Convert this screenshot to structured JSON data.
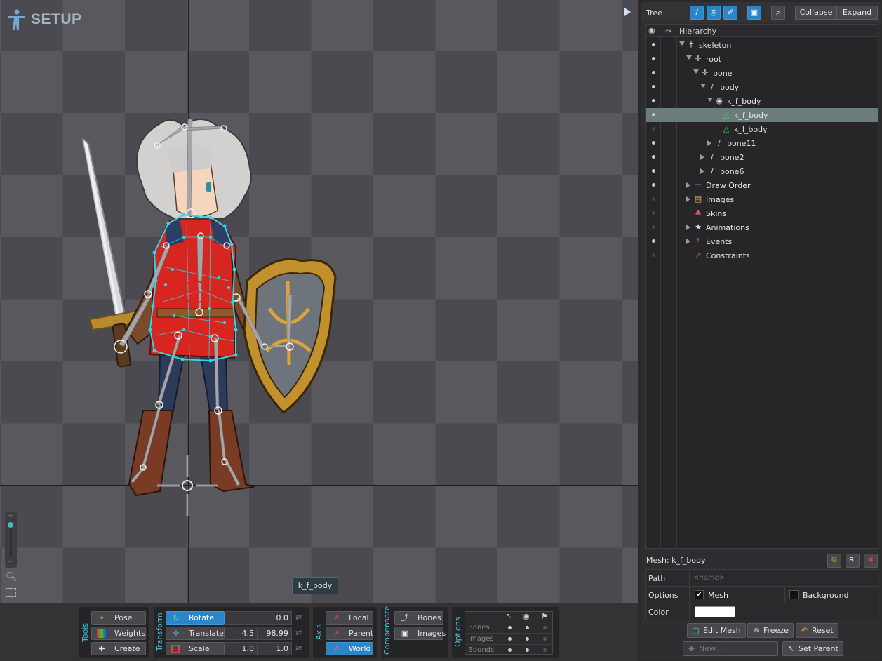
{
  "mode": {
    "label": "SETUP"
  },
  "viewport": {
    "selection_label": "k_f_body",
    "zoom": {
      "plus": "+",
      "minus": "-"
    }
  },
  "tools": {
    "title": "Tools",
    "items": [
      {
        "label": "Pose",
        "icon": "pose-icon",
        "active": false
      },
      {
        "label": "Weights",
        "icon": "weights-icon",
        "active": false
      },
      {
        "label": "Create",
        "icon": "create-icon",
        "active": false
      }
    ]
  },
  "transform": {
    "title": "Transform",
    "rotate": {
      "label": "Rotate",
      "value": "0.0",
      "active": true
    },
    "translate": {
      "label": "Translate",
      "x": "4.5",
      "y": "98.99"
    },
    "scale": {
      "label": "Scale",
      "x": "1.0",
      "y": "1.0"
    }
  },
  "axis": {
    "title": "Axis",
    "items": [
      {
        "label": "Local",
        "active": false
      },
      {
        "label": "Parent",
        "active": false
      },
      {
        "label": "World",
        "active": true
      }
    ]
  },
  "compensate": {
    "title": "Compensate",
    "items": [
      {
        "label": "Bones"
      },
      {
        "label": "Images"
      }
    ]
  },
  "options": {
    "title": "Options",
    "rows": [
      {
        "label": "Bones",
        "values": [
          true,
          true,
          false
        ]
      },
      {
        "label": "Images",
        "values": [
          true,
          true,
          false
        ]
      },
      {
        "label": "Bounds",
        "values": [
          true,
          true,
          false
        ]
      }
    ]
  },
  "tree_panel": {
    "title": "Tree",
    "collapse_label": "Collapse",
    "expand_label": "Expand",
    "header": "Hierarchy",
    "nodes": [
      {
        "label": "skeleton",
        "icon": "skeleton-icon",
        "depth": 0,
        "arrow": "down",
        "visible": true
      },
      {
        "label": "root",
        "icon": "bone-cross-icon",
        "depth": 1,
        "arrow": "down",
        "visible": true
      },
      {
        "label": "bone",
        "icon": "bone-cross-icon",
        "depth": 2,
        "arrow": "down",
        "visible": true
      },
      {
        "label": "body",
        "icon": "bone-icon",
        "depth": 3,
        "arrow": "down",
        "visible": true
      },
      {
        "label": "k_f_body",
        "icon": "slot-icon",
        "depth": 4,
        "arrow": "down",
        "visible": true
      },
      {
        "label": "k_f_body",
        "icon": "mesh-icon",
        "depth": 5,
        "arrow": "none",
        "visible": true,
        "selected": true
      },
      {
        "label": "k_l_body",
        "icon": "mesh-icon",
        "depth": 5,
        "arrow": "none",
        "visible": false
      },
      {
        "label": "bone11",
        "icon": "bone-icon",
        "depth": 4,
        "arrow": "right",
        "visible": true
      },
      {
        "label": "bone2",
        "icon": "bone-icon",
        "depth": 3,
        "arrow": "right",
        "visible": true
      },
      {
        "label": "bone6",
        "icon": "bone-icon",
        "depth": 3,
        "arrow": "right",
        "visible": true
      },
      {
        "label": "Draw Order",
        "icon": "draw-order-icon",
        "depth": 1,
        "arrow": "right",
        "visible": true
      },
      {
        "label": "Images",
        "icon": "images-folder-icon",
        "depth": 1,
        "arrow": "right",
        "visible": false
      },
      {
        "label": "Skins",
        "icon": "skins-icon",
        "depth": 1,
        "arrow": "none",
        "visible": false
      },
      {
        "label": "Animations",
        "icon": "animations-icon",
        "depth": 1,
        "arrow": "right",
        "visible": false
      },
      {
        "label": "Events",
        "icon": "events-icon",
        "depth": 1,
        "arrow": "right",
        "visible": true
      },
      {
        "label": "Constraints",
        "icon": "constraints-icon",
        "depth": 1,
        "arrow": "none",
        "visible": false
      }
    ]
  },
  "properties": {
    "title": "Mesh: k_f_body",
    "path": {
      "label": "Path",
      "placeholder": "<name>"
    },
    "options": {
      "label": "Options",
      "mesh_label": "Mesh",
      "mesh_checked": true,
      "background_label": "Background",
      "background_checked": false
    },
    "color": {
      "label": "Color",
      "value": "#ffffff"
    },
    "buttons": {
      "edit_mesh": "Edit Mesh",
      "freeze": "Freeze",
      "reset": "Reset",
      "new": "New...",
      "set_parent": "Set Parent"
    }
  },
  "colors": {
    "accent": "#2a85c9",
    "mesh": "#33d6e6",
    "selection_row": "#6b7c7c",
    "axis_title": "#47c4d8"
  }
}
